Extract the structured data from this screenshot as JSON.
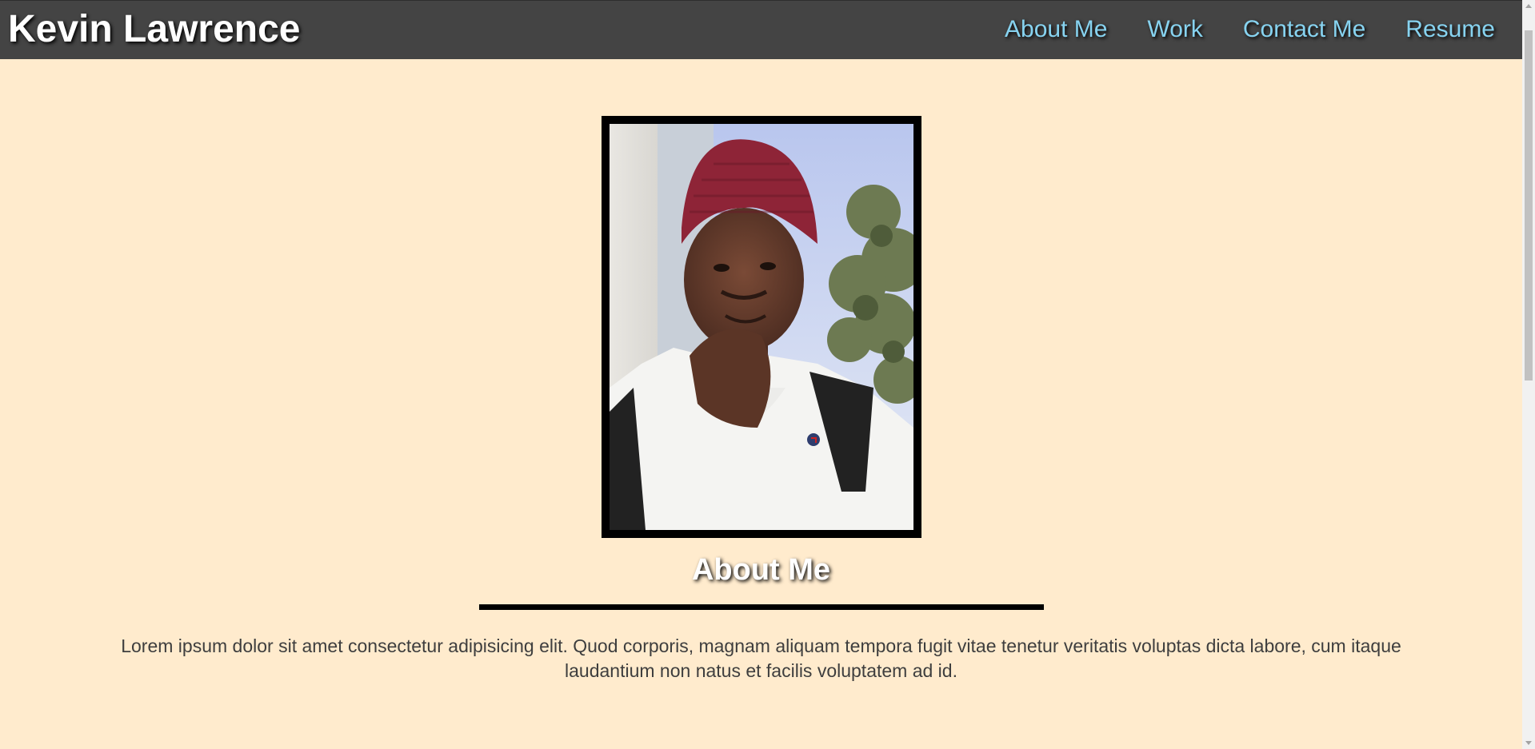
{
  "header": {
    "brand": "Kevin Lawrence",
    "nav": [
      {
        "label": "About Me"
      },
      {
        "label": "Work"
      },
      {
        "label": "Contact Me"
      },
      {
        "label": "Resume"
      }
    ]
  },
  "about": {
    "heading": "About Me",
    "text": "Lorem ipsum dolor sit amet consectetur adipisicing elit. Quod corporis, magnam aliquam tempora fugit vitae tenetur veritatis voluptas dicta labore, cum itaque laudantium non natus et facilis voluptatem ad id."
  },
  "colors": {
    "background": "#ffebcd",
    "navbar": "#444444",
    "nav_link": "#87d3f0"
  }
}
